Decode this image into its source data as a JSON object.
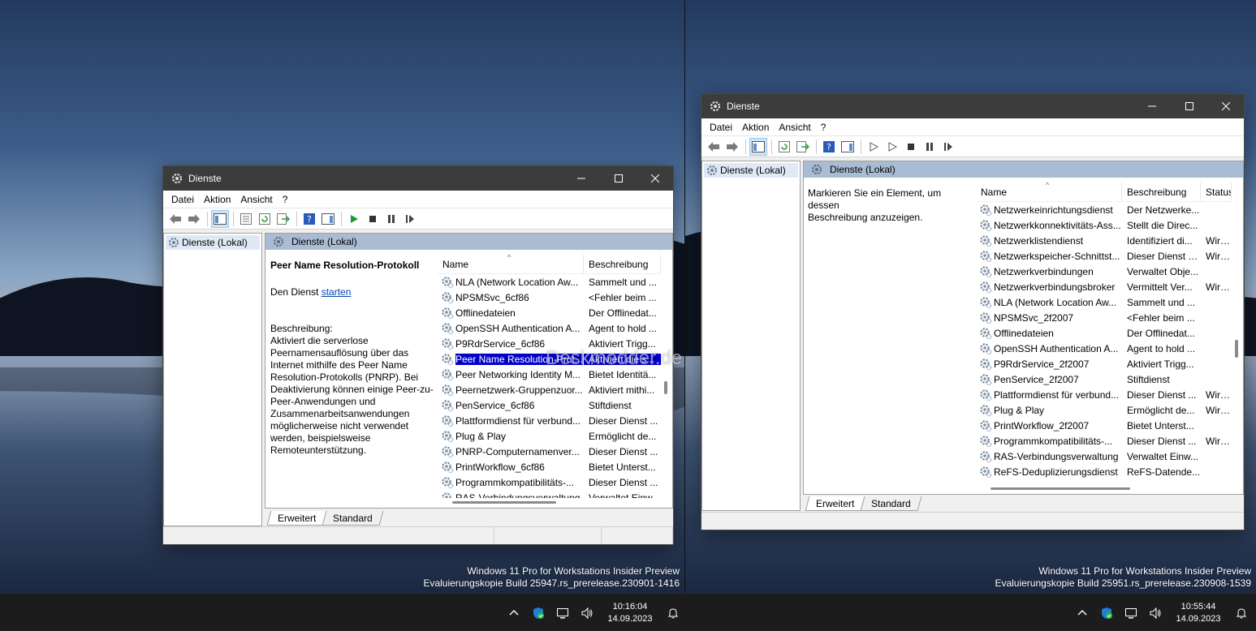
{
  "desktop_left": {
    "watermark_line1": "Windows 11 Pro for Workstations Insider Preview",
    "watermark_line2": "Evaluierungskopie Build 25947.rs_prerelease.230901-1416",
    "clock_time": "10:16:04",
    "clock_date": "14.09.2023"
  },
  "desktop_right": {
    "watermark_line1": "Windows 11 Pro for Workstations Insider Preview",
    "watermark_line2": "Evaluierungskopie Build 25951.rs_prerelease.230908-1539",
    "clock_time": "10:55:44",
    "clock_date": "14.09.2023"
  },
  "overlay_watermark": "Deskmodder.de",
  "colors": {
    "selection": "#0000c8",
    "titlebar": "#3c3c3c",
    "panel_header": "#a9bcd3",
    "link": "#0645ad"
  },
  "win1": {
    "title": "Dienste",
    "menu": [
      "Datei",
      "Aktion",
      "Ansicht",
      "?"
    ],
    "tree_item": "Dienste (Lokal)",
    "panel_title": "Dienste (Lokal)",
    "service_title": "Peer Name Resolution-Protokoll",
    "action_prefix": "Den Dienst ",
    "action_link": "starten",
    "desc_label": "Beschreibung:",
    "desc_lines": [
      "Aktiviert die serverlose",
      "Peernamensauflösung über das",
      "Internet mithilfe des Peer Name",
      "Resolution-Protokolls (PNRP). Bei",
      "Deaktivierung können einige Peer-zu-",
      "Peer-Anwendungen und",
      "Zusammenarbeitsanwendungen",
      "möglicherweise nicht verwendet",
      "werden, beispielsweise",
      "Remoteunterstützung."
    ],
    "col_name": "Name",
    "col_desc": "Beschreibung",
    "rows": [
      {
        "name": "NLA (Network Location Aw...",
        "desc": "Sammelt und ..."
      },
      {
        "name": "NPSMSvc_6cf86",
        "desc": "<Fehler beim ..."
      },
      {
        "name": "Offlinedateien",
        "desc": "Der Offlinedat..."
      },
      {
        "name": "OpenSSH Authentication A...",
        "desc": "Agent to hold ..."
      },
      {
        "name": "P9RdrService_6cf86",
        "desc": "Aktiviert Trigg..."
      },
      {
        "name": "Peer Name Resolution-Prot...",
        "desc": "Aktiviert die s...",
        "selected": true
      },
      {
        "name": "Peer Networking Identity M...",
        "desc": "Bietet Identitä..."
      },
      {
        "name": "Peernetzwerk-Gruppenzuor...",
        "desc": "Aktiviert mithi..."
      },
      {
        "name": "PenService_6cf86",
        "desc": "Stiftdienst"
      },
      {
        "name": "Plattformdienst für verbund...",
        "desc": "Dieser Dienst ..."
      },
      {
        "name": "Plug & Play",
        "desc": "Ermöglicht de..."
      },
      {
        "name": "PNRP-Computernamenver...",
        "desc": "Dieser Dienst ..."
      },
      {
        "name": "PrintWorkflow_6cf86",
        "desc": "Bietet Unterst..."
      },
      {
        "name": "Programmkompatibilitäts-...",
        "desc": "Dieser Dienst ..."
      },
      {
        "name": "RAS-Verbindungsverwaltung",
        "desc": "Verwaltet Einw..."
      }
    ],
    "tab_extended": "Erweitert",
    "tab_standard": "Standard"
  },
  "win2": {
    "title": "Dienste",
    "menu": [
      "Datei",
      "Aktion",
      "Ansicht",
      "?"
    ],
    "tree_item": "Dienste (Lokal)",
    "panel_title": "Dienste (Lokal)",
    "hint_line1": "Markieren Sie ein Element, um dessen",
    "hint_line2": "Beschreibung anzuzeigen.",
    "col_name": "Name",
    "col_desc": "Beschreibung",
    "col_status": "Status",
    "rows": [
      {
        "name": "Netzwerkeinrichtungsdienst",
        "desc": "Der Netzwerke...",
        "status": ""
      },
      {
        "name": "Netzwerkkonnektivitäts-Ass...",
        "desc": "Stellt die Direc...",
        "status": ""
      },
      {
        "name": "Netzwerklistendienst",
        "desc": "Identifiziert di...",
        "status": "Wird ..."
      },
      {
        "name": "Netzwerkspeicher-Schnittst...",
        "desc": "Dieser Dienst s...",
        "status": "Wird ..."
      },
      {
        "name": "Netzwerkverbindungen",
        "desc": "Verwaltet Obje...",
        "status": ""
      },
      {
        "name": "Netzwerkverbindungsbroker",
        "desc": "Vermittelt Ver...",
        "status": "Wird ..."
      },
      {
        "name": "NLA (Network Location Aw...",
        "desc": "Sammelt und ...",
        "status": ""
      },
      {
        "name": "NPSMSvc_2f2007",
        "desc": "<Fehler beim ...",
        "status": ""
      },
      {
        "name": "Offlinedateien",
        "desc": "Der Offlinedat...",
        "status": ""
      },
      {
        "name": "OpenSSH Authentication A...",
        "desc": "Agent to hold ...",
        "status": ""
      },
      {
        "name": "P9RdrService_2f2007",
        "desc": "Aktiviert Trigg...",
        "status": ""
      },
      {
        "name": "PenService_2f2007",
        "desc": "Stiftdienst",
        "status": ""
      },
      {
        "name": "Plattformdienst für verbund...",
        "desc": "Dieser Dienst ...",
        "status": "Wird ..."
      },
      {
        "name": "Plug & Play",
        "desc": "Ermöglicht de...",
        "status": "Wird ..."
      },
      {
        "name": "PrintWorkflow_2f2007",
        "desc": "Bietet Unterst...",
        "status": ""
      },
      {
        "name": "Programmkompatibilitäts-...",
        "desc": "Dieser Dienst ...",
        "status": "Wird ..."
      },
      {
        "name": "RAS-Verbindungsverwaltung",
        "desc": "Verwaltet Einw...",
        "status": ""
      },
      {
        "name": "ReFS-Deduplizierungsdienst",
        "desc": "ReFS-Datende...",
        "status": ""
      }
    ],
    "tab_extended": "Erweitert",
    "tab_standard": "Standard"
  }
}
